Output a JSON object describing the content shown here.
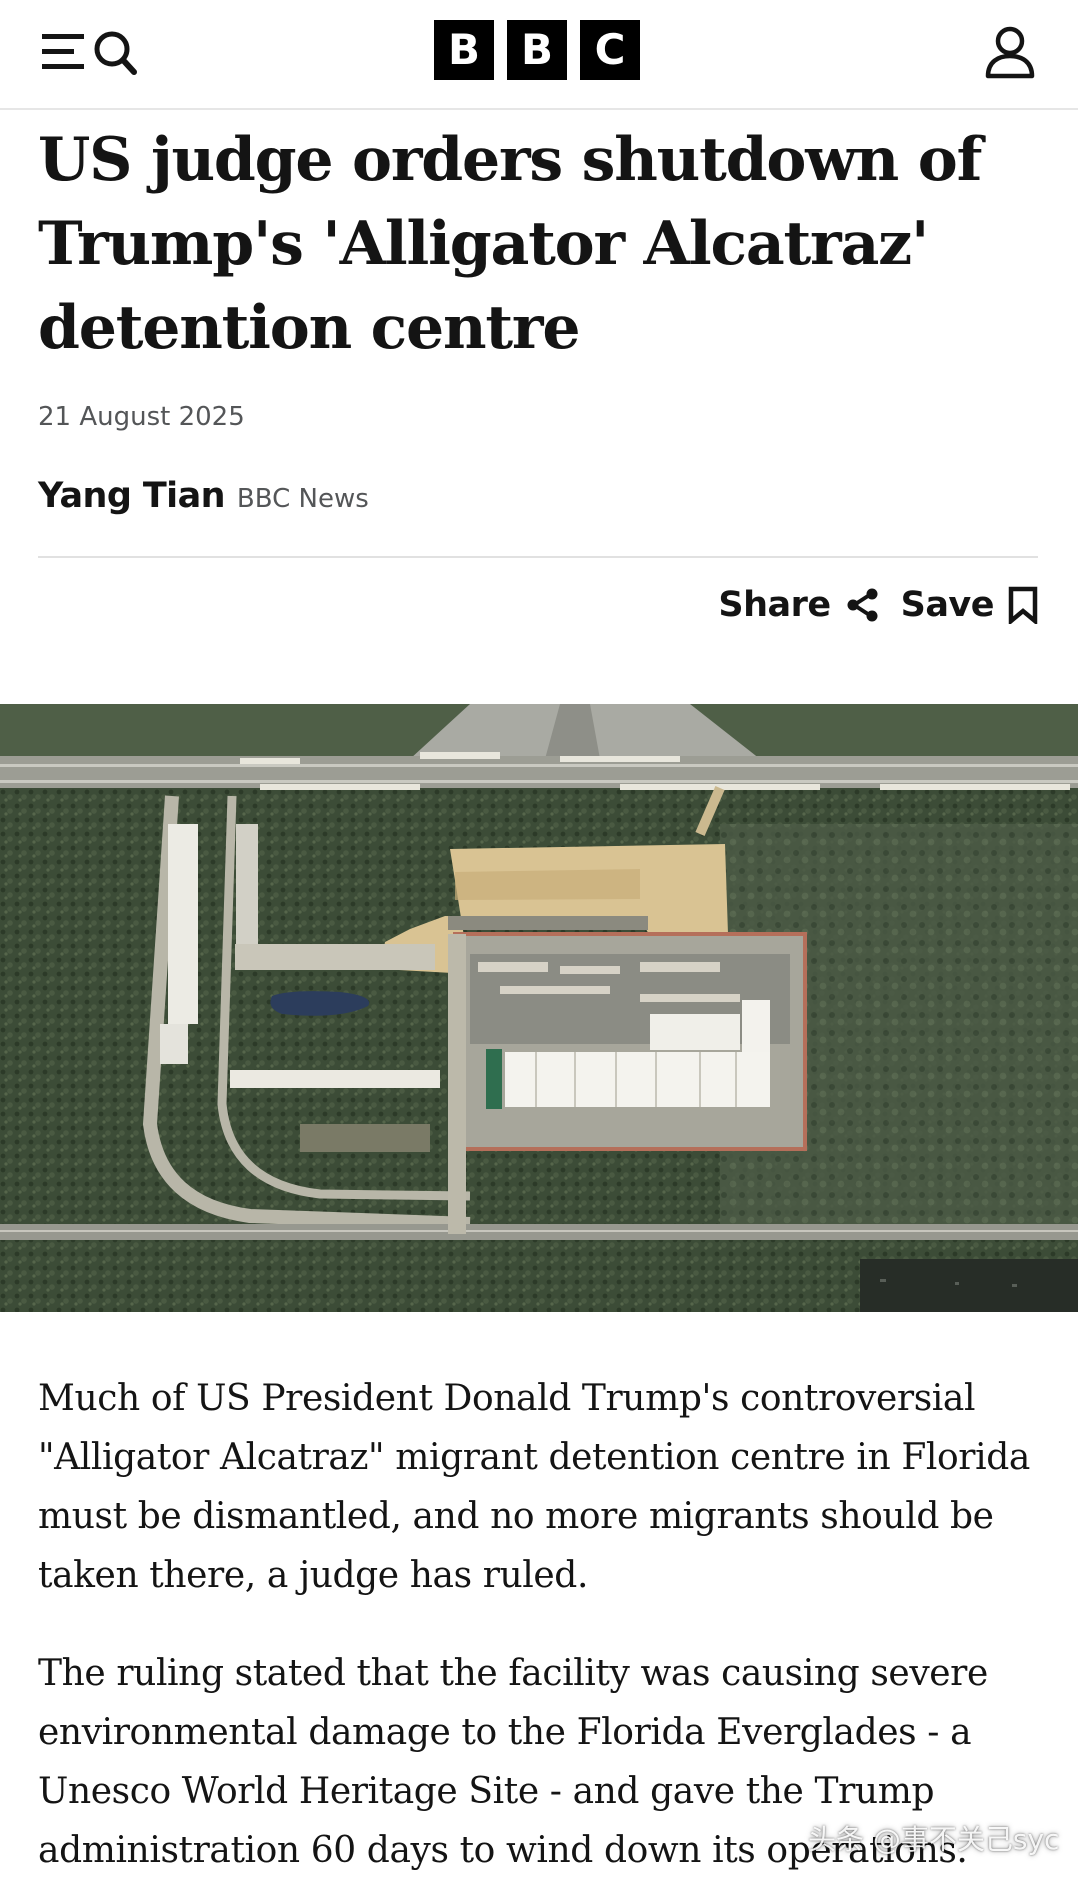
{
  "header": {
    "menu_icon": "hamburger-icon",
    "search_icon": "search-icon",
    "brand_letters": [
      "B",
      "B",
      "C"
    ],
    "account_icon": "user-icon"
  },
  "article": {
    "headline": "US judge orders shutdown of Trump's 'Alligator Alcatraz' detention centre",
    "date": "21 August 2025",
    "author": "Yang Tian",
    "outlet": "BBC News",
    "share_label": "Share",
    "share_icon": "share-icon",
    "save_label": "Save",
    "save_icon": "bookmark-icon",
    "image": "aerial-photo",
    "paragraphs": [
      "Much of US President Donald Trump's controversial \"Alligator Alcatraz\" migrant detention centre in Florida must be dismantled, and no more migrants should be taken there, a judge has ruled.",
      "The ruling stated that the facility was causing severe environmental damage to the Florida Everglades - a Unesco World Heritage Site - and gave the Trump administration 60 days to wind down its operations."
    ]
  },
  "watermark": {
    "text": "头条 @事不关己syc"
  },
  "colors": {
    "text": "#141414",
    "meta": "#545658",
    "brand_bg": "#000000",
    "brand_fg": "#ffffff",
    "divider": "#e1e1e1"
  }
}
